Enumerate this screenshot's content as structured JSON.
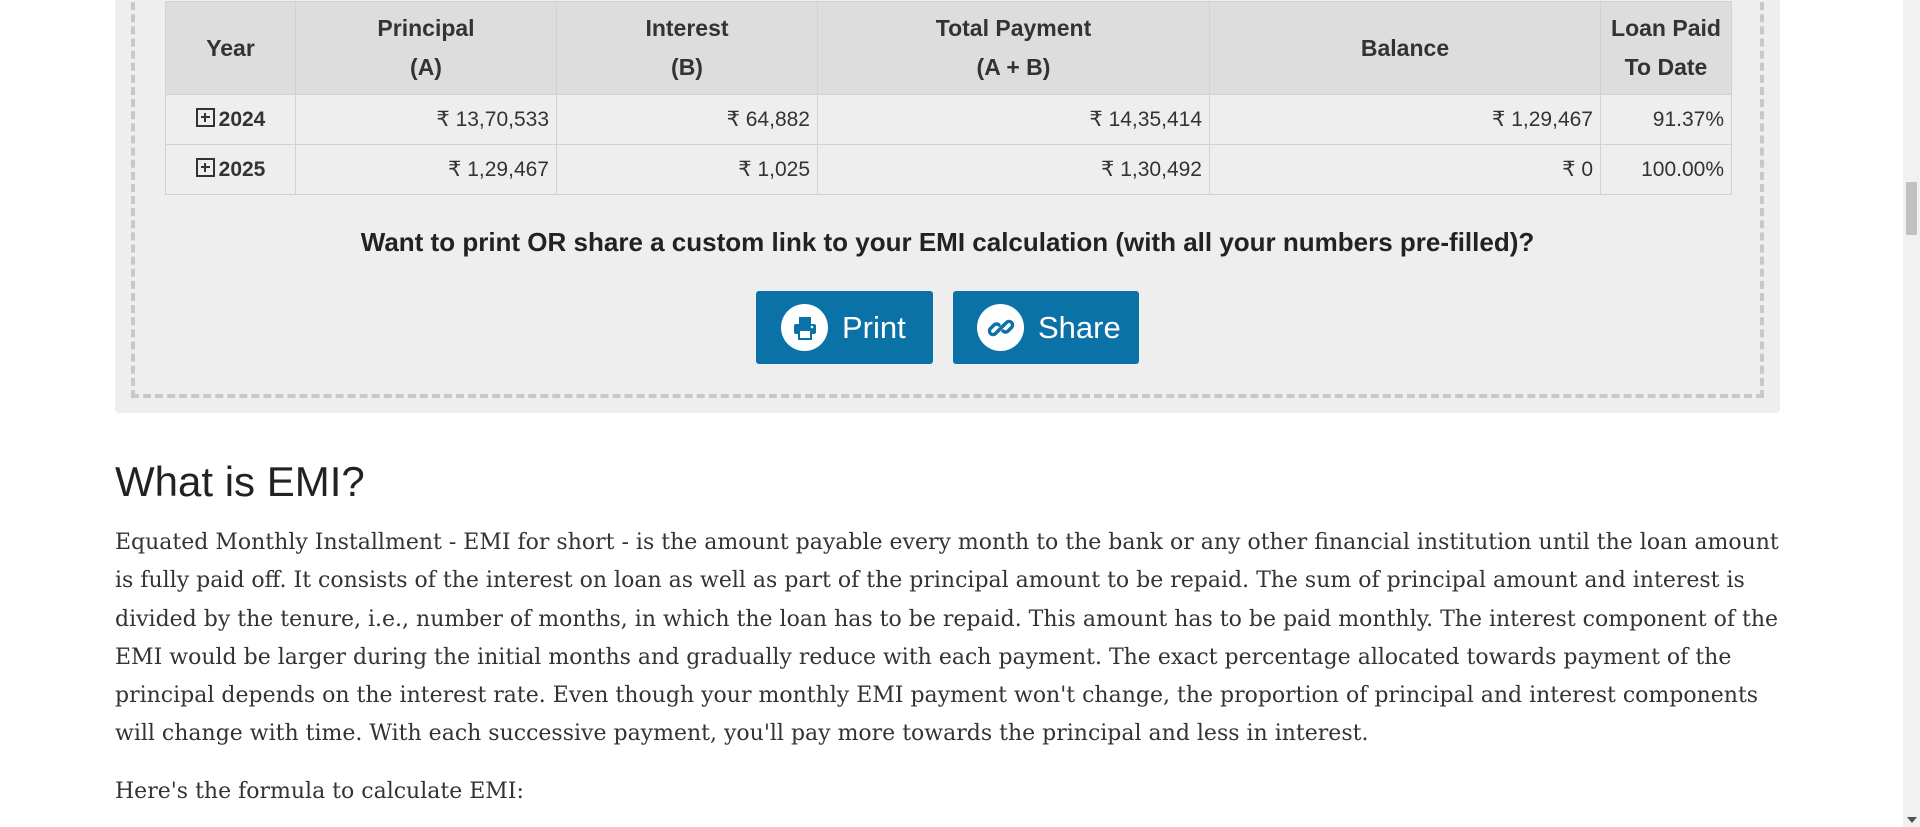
{
  "table": {
    "headers": [
      {
        "line1": "Year",
        "line2": ""
      },
      {
        "line1": "Principal",
        "line2": "(A)"
      },
      {
        "line1": "Interest",
        "line2": "(B)"
      },
      {
        "line1": "Total Payment",
        "line2": "(A + B)"
      },
      {
        "line1": "Balance",
        "line2": ""
      },
      {
        "line1": "Loan Paid",
        "line2": "To Date"
      }
    ],
    "rows": [
      {
        "year": "2024",
        "principal": "₹ 13,70,533",
        "interest": "₹ 64,882",
        "total": "₹ 14,35,414",
        "balance": "₹ 1,29,467",
        "paid": "91.37%"
      },
      {
        "year": "2025",
        "principal": "₹ 1,29,467",
        "interest": "₹ 1,025",
        "total": "₹ 1,30,492",
        "balance": "₹ 0",
        "paid": "100.00%"
      }
    ],
    "colors": {
      "principal": "#86a92a",
      "interest": "#ee8e2f",
      "balance": "#bb1f4a"
    }
  },
  "share": {
    "question": "Want to print OR share a custom link to your EMI calculation (with all your numbers pre-filled)?",
    "print_label": "Print",
    "share_label": "Share",
    "print_icon": "printer-icon",
    "share_icon": "link-icon",
    "button_color": "#0b72a8"
  },
  "article": {
    "title": "What is EMI?",
    "paragraph": "Equated Monthly Installment - EMI for short - is the amount payable every month to the bank or any other financial institution until the loan amount is fully paid off. It consists of the interest on loan as well as part of the principal amount to be repaid. The sum of principal amount and interest is divided by the tenure, i.e., number of months, in which the loan has to be repaid. This amount has to be paid monthly. The interest component of the EMI would be larger during the initial months and gradually reduce with each payment. The exact percentage allocated towards payment of the principal depends on the interest rate. Even though your monthly EMI payment won't change, the proportion of principal and interest components will change with time. With each successive payment, you'll pay more towards the principal and less in interest.",
    "formula_intro": "Here's the formula to calculate EMI:"
  }
}
